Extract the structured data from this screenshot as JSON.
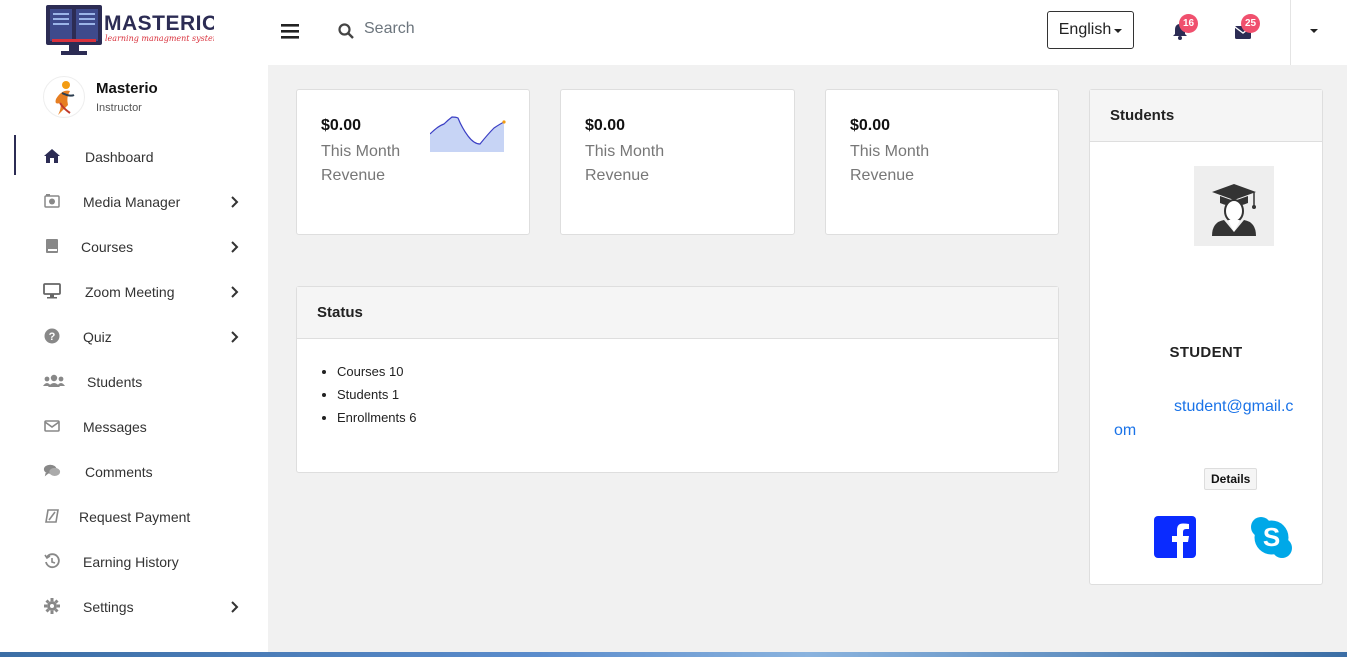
{
  "brand": {
    "name": "MASTERIO",
    "tagline": "learning managment system",
    "colors": {
      "brand_red": "#d9323d",
      "dark": "#2c2c54"
    }
  },
  "profile": {
    "name": "Masterio",
    "role": "Instructor",
    "avatar_icon": "runner-avatar"
  },
  "sidebar": {
    "items": [
      {
        "label": "Dashboard",
        "icon": "home-icon",
        "active": true,
        "has_children": false
      },
      {
        "label": "Media Manager",
        "icon": "camera-icon",
        "active": false,
        "has_children": true
      },
      {
        "label": "Courses",
        "icon": "book-icon",
        "active": false,
        "has_children": true
      },
      {
        "label": "Zoom Meeting",
        "icon": "monitor-icon",
        "active": false,
        "has_children": true
      },
      {
        "label": "Quiz",
        "icon": "question-icon",
        "active": false,
        "has_children": true
      },
      {
        "label": "Students",
        "icon": "users-icon",
        "active": false,
        "has_children": false
      },
      {
        "label": "Messages",
        "icon": "envelope-icon",
        "active": false,
        "has_children": false
      },
      {
        "label": "Comments",
        "icon": "comments-icon",
        "active": false,
        "has_children": false
      },
      {
        "label": "Request Payment",
        "icon": "payment-icon",
        "active": false,
        "has_children": false
      },
      {
        "label": "Earning History",
        "icon": "history-icon",
        "active": false,
        "has_children": false
      },
      {
        "label": "Settings",
        "icon": "gear-icon",
        "active": false,
        "has_children": true
      }
    ]
  },
  "topbar": {
    "search_placeholder": "Search",
    "language": "English",
    "notifications_count": "16",
    "messages_count": "25"
  },
  "stats": [
    {
      "amount": "$0.00",
      "label": "This Month Revenue",
      "has_sparkline": true
    },
    {
      "amount": "$0.00",
      "label": "This Month Revenue",
      "has_sparkline": false
    },
    {
      "amount": "$0.00",
      "label": "This Month Revenue",
      "has_sparkline": false
    }
  ],
  "status": {
    "title": "Status",
    "items": [
      "Courses 10",
      "Students 1",
      "Enrollments 6"
    ]
  },
  "students_panel": {
    "title": "Students",
    "student_name": "STUDENT",
    "email": "student@gmail.com",
    "details_label": "Details",
    "social": [
      "facebook-icon",
      "skype-icon"
    ]
  }
}
